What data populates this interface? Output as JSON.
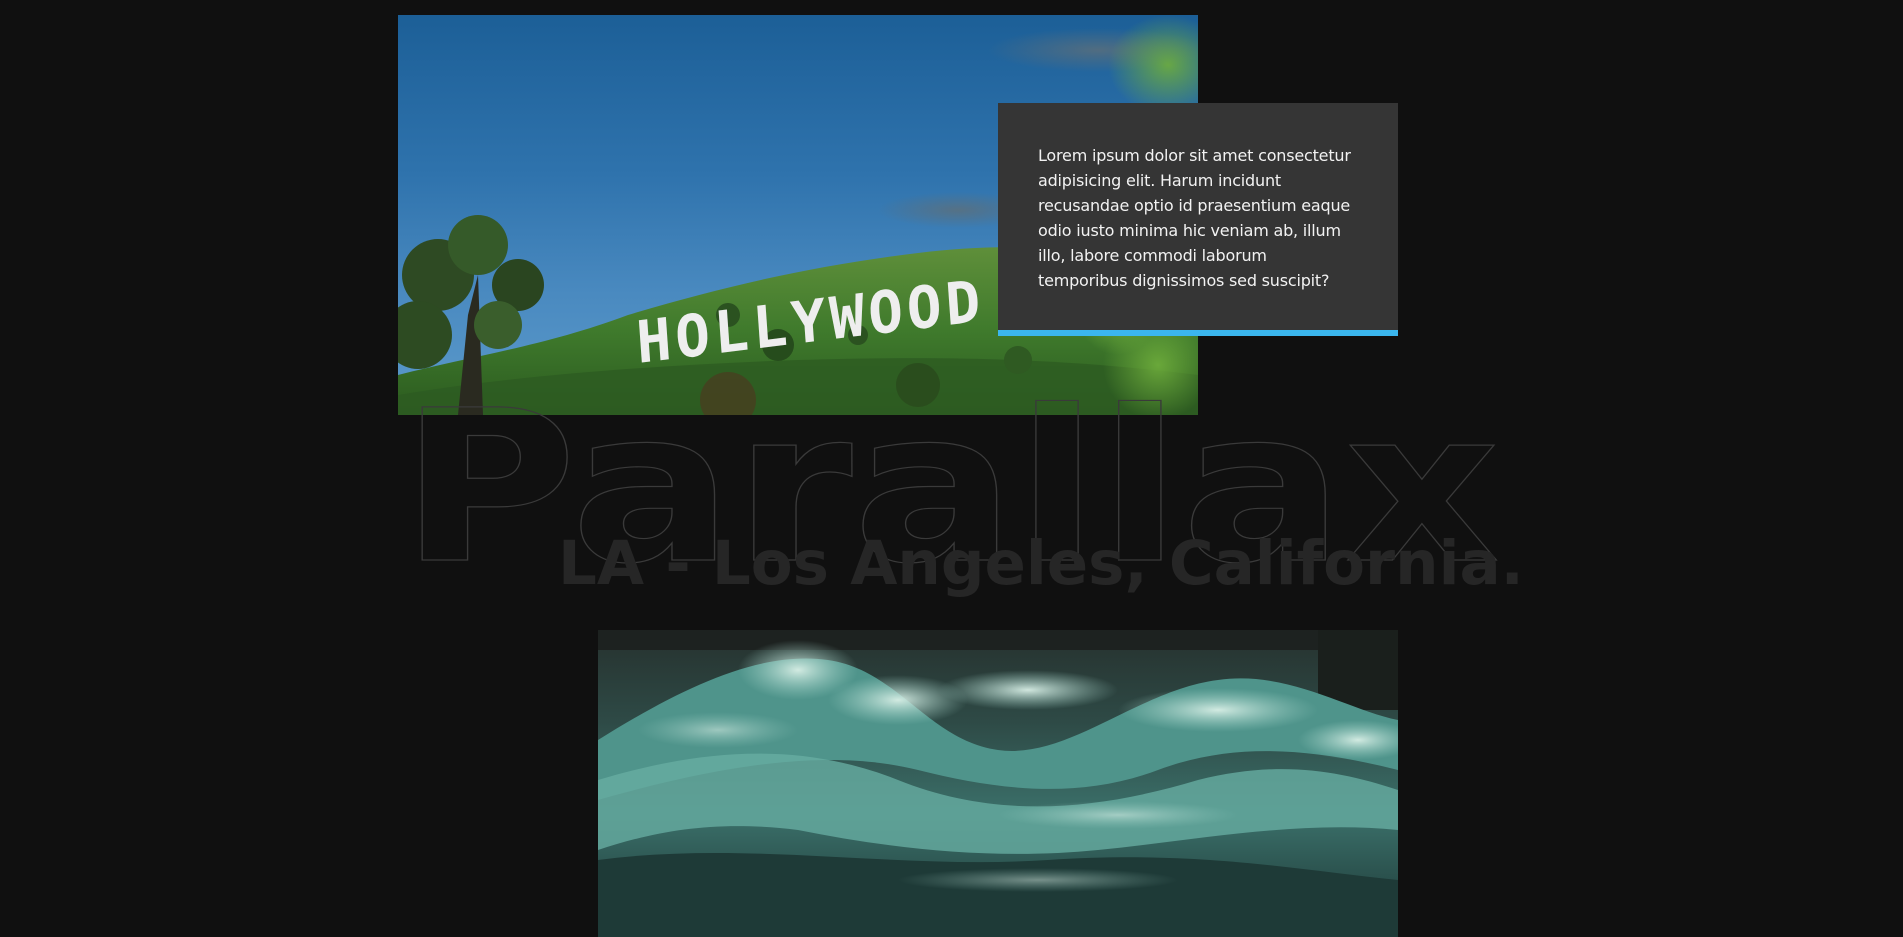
{
  "hero": {
    "image_alt": "Hollywood sign on a green hillside under a blue sky",
    "sign_text": "HOLLYWOOD"
  },
  "card": {
    "text": "Lorem ipsum dolor sit amet consectetur adipisicing elit. Harum incidunt recusandae optio id praesentium eaque odio iusto minima hic veniam ab, illum illo, labore commodi laborum temporibus dignissimos sed suscipit?",
    "accent_color": "#3bb6ee"
  },
  "headline": {
    "word": "Parallax",
    "subtitle": "LA - Los Angeles, California."
  },
  "waves": {
    "image_alt": "Teal ocean waves crashing"
  },
  "colors": {
    "background": "#101010",
    "card_background": "#353535"
  }
}
